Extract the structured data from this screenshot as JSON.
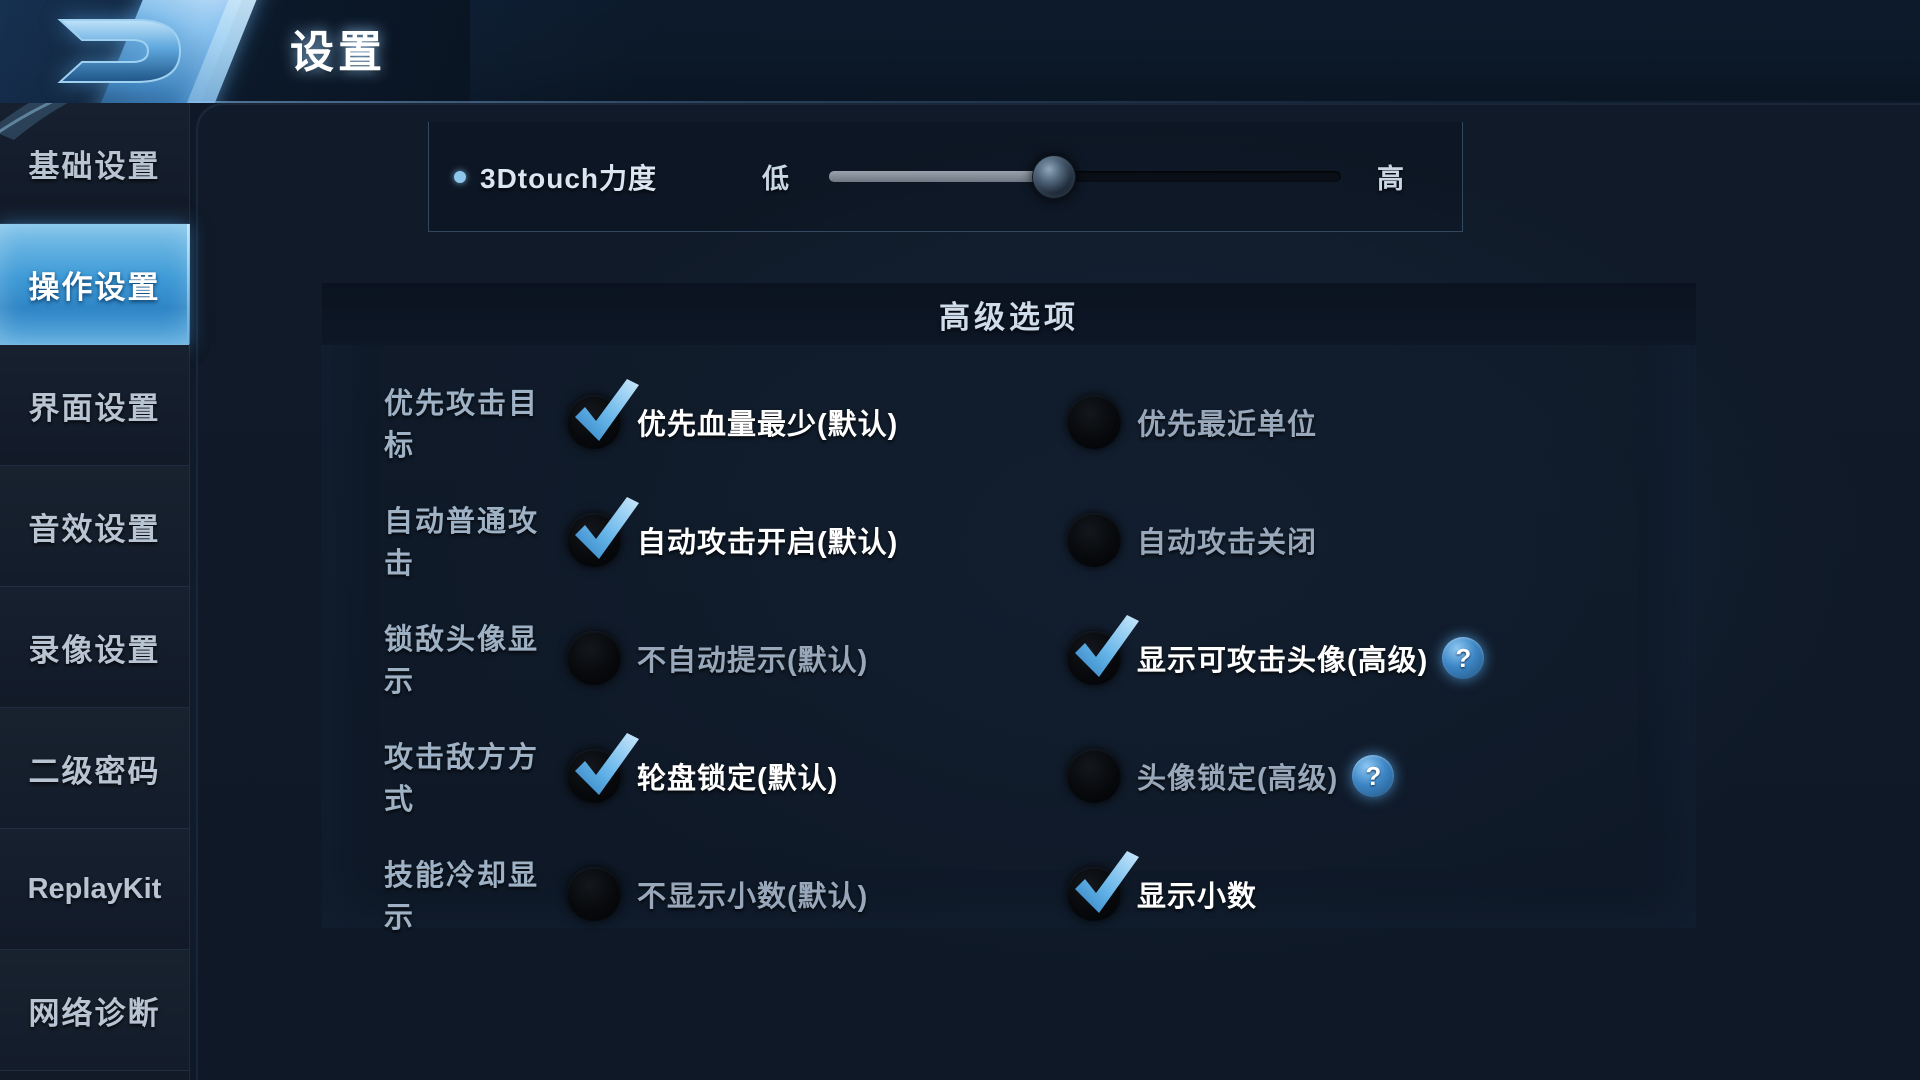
{
  "header": {
    "title": "设置",
    "logo_icon": "game-logo-d-glyph"
  },
  "sidebar": {
    "items": [
      {
        "label": "基础设置",
        "active": false
      },
      {
        "label": "操作设置",
        "active": true
      },
      {
        "label": "界面设置",
        "active": false
      },
      {
        "label": "音效设置",
        "active": false
      },
      {
        "label": "录像设置",
        "active": false
      },
      {
        "label": "二级密码",
        "active": false
      },
      {
        "label": "ReplayKit",
        "active": false
      },
      {
        "label": "网络诊断",
        "active": false
      }
    ]
  },
  "slider_setting": {
    "label": "3Dtouch力度",
    "min_label": "低",
    "max_label": "高",
    "value_percent": 44
  },
  "advanced": {
    "title": "高级选项",
    "rows": [
      {
        "label": "优先攻击目标",
        "left": {
          "text": "优先血量最少(默认)",
          "checked": true,
          "help": false
        },
        "right": {
          "text": "优先最近单位",
          "checked": false,
          "help": false
        }
      },
      {
        "label": "自动普通攻击",
        "left": {
          "text": "自动攻击开启(默认)",
          "checked": true,
          "help": false
        },
        "right": {
          "text": "自动攻击关闭",
          "checked": false,
          "help": false
        }
      },
      {
        "label": "锁敌头像显示",
        "left": {
          "text": "不自动提示(默认)",
          "checked": false,
          "help": false
        },
        "right": {
          "text": "显示可攻击头像(高级)",
          "checked": true,
          "help": true
        }
      },
      {
        "label": "攻击敌方方式",
        "left": {
          "text": "轮盘锁定(默认)",
          "checked": true,
          "help": false
        },
        "right": {
          "text": "头像锁定(高级)",
          "checked": false,
          "help": true
        }
      },
      {
        "label": "技能冷却显示",
        "left": {
          "text": "不显示小数(默认)",
          "checked": false,
          "help": false
        },
        "right": {
          "text": "显示小数",
          "checked": true,
          "help": false
        }
      }
    ],
    "help_glyph": "?"
  },
  "colors": {
    "accent_blue": "#3e9ad6",
    "highlight_cyan": "#8fc6ec",
    "panel_dark": "#101a28",
    "text_on": "#ffffff",
    "text_off": "#98a8ba"
  }
}
